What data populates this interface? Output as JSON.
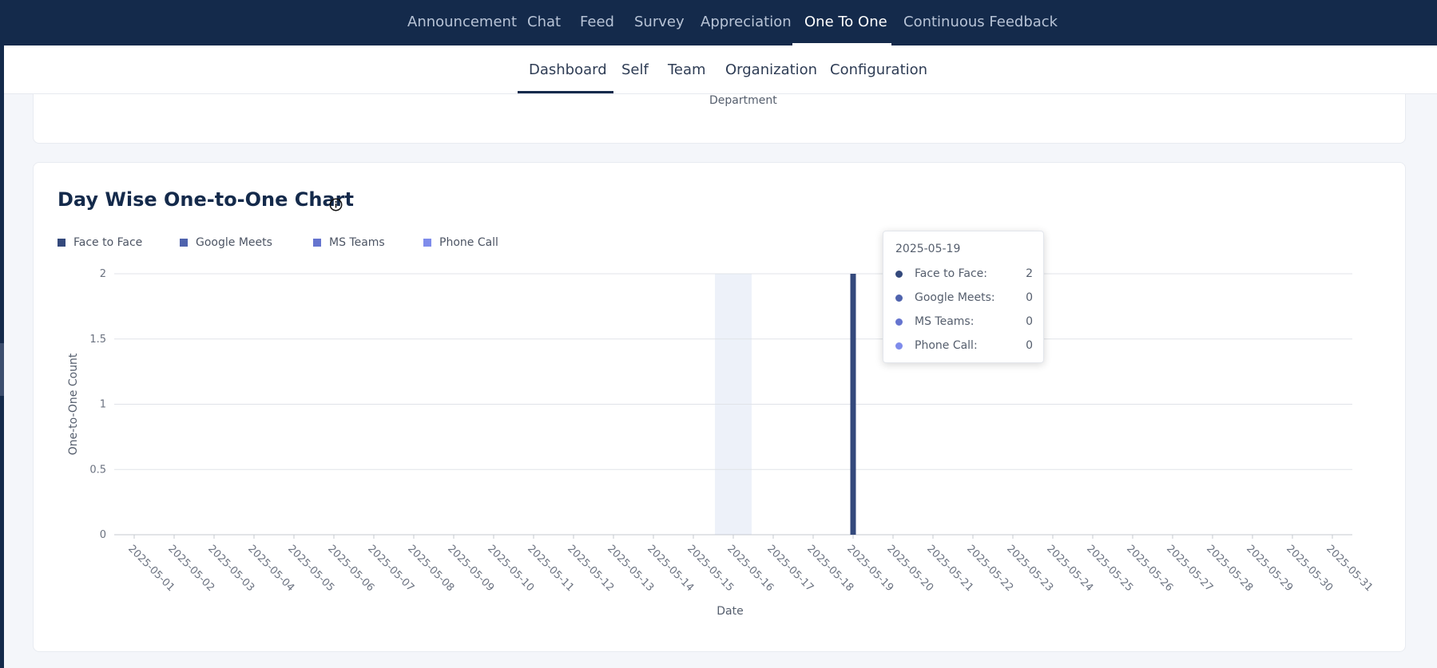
{
  "top_nav": {
    "items": [
      {
        "label": "Announcement",
        "active": false
      },
      {
        "label": "Chat",
        "active": false
      },
      {
        "label": "Feed",
        "active": false
      },
      {
        "label": "Survey",
        "active": false
      },
      {
        "label": "Appreciation",
        "active": false
      },
      {
        "label": "One To One",
        "active": true
      },
      {
        "label": "Continuous Feedback",
        "active": false
      }
    ]
  },
  "sub_nav": {
    "items": [
      {
        "label": "Dashboard",
        "active": true
      },
      {
        "label": "Self",
        "active": false
      },
      {
        "label": "Team",
        "active": false
      },
      {
        "label": "Organization",
        "active": false
      },
      {
        "label": "Configuration",
        "active": false
      }
    ]
  },
  "previous_card": {
    "axis_label": "Department"
  },
  "chart_card": {
    "title": "Day Wise One-to-One Chart",
    "info_icon": "info-icon"
  },
  "tooltip": {
    "date": "2025-05-19",
    "rows": [
      {
        "label": "Face to Face:",
        "value": "2",
        "color": "#34497c"
      },
      {
        "label": "Google Meets:",
        "value": "0",
        "color": "#4f63ad"
      },
      {
        "label": "MS Teams:",
        "value": "0",
        "color": "#6574cf"
      },
      {
        "label": "Phone Call:",
        "value": "0",
        "color": "#7f8ceb"
      }
    ]
  },
  "chart_data": {
    "type": "bar",
    "stacked": true,
    "xlabel": "Date",
    "ylabel": "One-to-One Count",
    "ylim": [
      0,
      2
    ],
    "yticks": [
      "0",
      "0.5",
      "1",
      "1.5",
      "2"
    ],
    "grid": true,
    "legend_position": "top-left",
    "highlighted_category": "2025-05-16",
    "categories": [
      "2025-05-01",
      "2025-05-02",
      "2025-05-03",
      "2025-05-04",
      "2025-05-05",
      "2025-05-06",
      "2025-05-07",
      "2025-05-08",
      "2025-05-09",
      "2025-05-10",
      "2025-05-11",
      "2025-05-12",
      "2025-05-13",
      "2025-05-14",
      "2025-05-15",
      "2025-05-16",
      "2025-05-17",
      "2025-05-18",
      "2025-05-19",
      "2025-05-20",
      "2025-05-21",
      "2025-05-22",
      "2025-05-23",
      "2025-05-24",
      "2025-05-25",
      "2025-05-26",
      "2025-05-27",
      "2025-05-28",
      "2025-05-29",
      "2025-05-30",
      "2025-05-31"
    ],
    "series": [
      {
        "name": "Face to Face",
        "color": "#34497c",
        "values": [
          0,
          0,
          0,
          0,
          0,
          0,
          0,
          0,
          0,
          0,
          0,
          0,
          0,
          0,
          0,
          0,
          0,
          0,
          2,
          0,
          0,
          0,
          0,
          0,
          0,
          0,
          0,
          0,
          0,
          0,
          0
        ]
      },
      {
        "name": "Google Meets",
        "color": "#4f63ad",
        "values": [
          0,
          0,
          0,
          0,
          0,
          0,
          0,
          0,
          0,
          0,
          0,
          0,
          0,
          0,
          0,
          0,
          0,
          0,
          0,
          0,
          0,
          0,
          0,
          0,
          0,
          0,
          0,
          0,
          0,
          0,
          0
        ]
      },
      {
        "name": "MS Teams",
        "color": "#6574cf",
        "values": [
          0,
          0,
          0,
          0,
          0,
          0,
          0,
          0,
          0,
          0,
          0,
          0,
          0,
          0,
          0,
          0,
          0,
          0,
          0,
          0,
          0,
          0,
          0,
          0,
          0,
          0,
          0,
          0,
          0,
          0,
          0
        ]
      },
      {
        "name": "Phone Call",
        "color": "#7f8ceb",
        "values": [
          0,
          0,
          0,
          0,
          0,
          0,
          0,
          0,
          0,
          0,
          0,
          0,
          0,
          0,
          0,
          0,
          0,
          0,
          0,
          0,
          0,
          0,
          0,
          0,
          0,
          0,
          0,
          0,
          0,
          0,
          0
        ]
      }
    ]
  }
}
